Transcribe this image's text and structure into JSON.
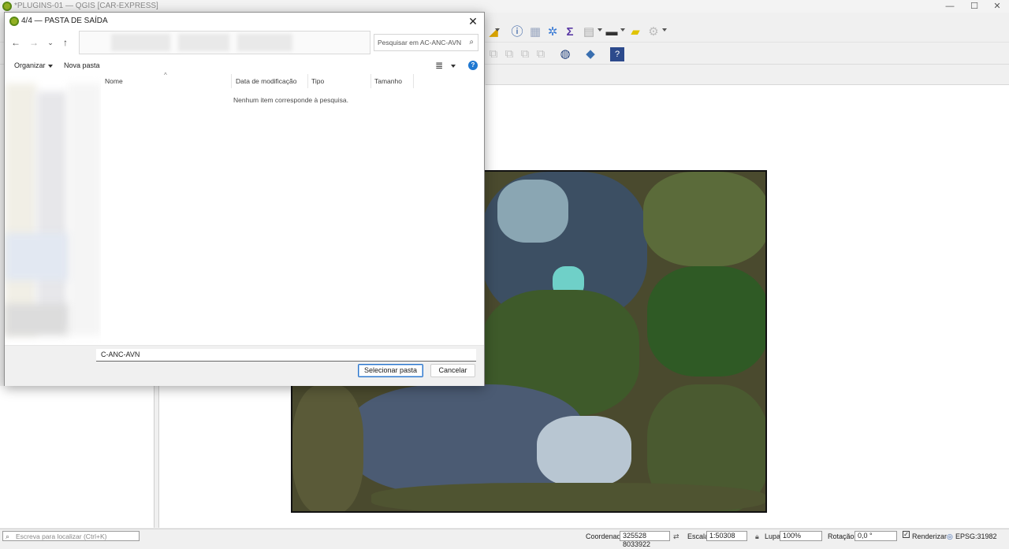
{
  "app": {
    "title": "*PLUGINS-01 — QGIS [CAR-EXPRESS]",
    "window_controls": {
      "minimize": "—",
      "maximize": "☐",
      "close": "✕"
    }
  },
  "toolbar_icons": [
    "identify-icon",
    "grid-icon",
    "gear-blue-icon",
    "sum-icon",
    "table-icon",
    "ruler-icon",
    "tooltip-icon",
    "settings-icon",
    "python-icon",
    "help-icon",
    "globe-icon"
  ],
  "dialog": {
    "title": "4/4 — PASTA DE SAÍDA",
    "close_glyph": "✕",
    "nav": {
      "back": "←",
      "forward": "→",
      "dropdown": "⌄",
      "up": "↑"
    },
    "search_placeholder": "Pesquisar em AC-ANC-AVN",
    "search_icon": "⌕",
    "commands": {
      "organize": "Organizar",
      "new_folder": "Nova pasta"
    },
    "view_icon": "≣",
    "help_glyph": "?",
    "columns": [
      "Nome",
      "Data de modificação",
      "Tipo",
      "Tamanho"
    ],
    "sort_caret": "^",
    "empty_message": "Nenhum item corresponde à pesquisa.",
    "folder_value": "C-ANC-AVN",
    "buttons": {
      "select": "Selecionar pasta",
      "cancel": "Cancelar"
    }
  },
  "statusbar": {
    "locator_placeholder": "Escreva para localizar (Ctrl+K)",
    "coord_label": "Coordenada",
    "coord_value": "325528  8033922",
    "scale_label": "Escala",
    "scale_value": "1:50308",
    "magnifier_label": "Lupa",
    "magnifier_value": "100%",
    "rotation_label": "Rotação",
    "rotation_value": "0,0 °",
    "render_label": "Renderizar",
    "render_checked": true,
    "crs": "EPSG:31982"
  },
  "colors": {
    "accent": "#2a74c9",
    "qgis_green": "#93b023",
    "help_blue": "#1f78d1"
  }
}
